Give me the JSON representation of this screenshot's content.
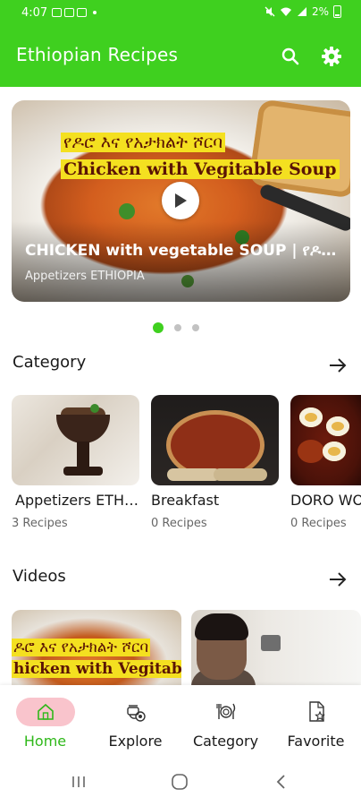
{
  "status_bar": {
    "time": "4:07",
    "battery": "2%"
  },
  "app_bar": {
    "title": "Ethiopian Recipes",
    "search_icon": "search-icon",
    "settings_icon": "gear-icon",
    "color": "#3fd01f"
  },
  "featured": {
    "caption_amharic": "የዶሮ እና የአታክልት ሾርባ",
    "caption_english": "Chicken with Vegitable Soup",
    "title": "CHICKEN with vegetable SOUP | የዶሮ...",
    "channel": "Appetizers ETHIOPIA",
    "active_page": 1,
    "page_count": 3
  },
  "category_section": {
    "title": "Category",
    "items": [
      {
        "name": "Appetizers ETHI...",
        "count": "3 Recipes"
      },
      {
        "name": "Breakfast",
        "count": "0 Recipes"
      },
      {
        "name": "DORO WO",
        "count": "0 Recipes"
      }
    ]
  },
  "videos_section": {
    "title": "Videos",
    "items": [
      {
        "caption_amharic": "ዶሮ እና የአታክልት ሾርባ",
        "caption_english": "hicken with Vegitable S"
      },
      {
        "caption_amharic": "",
        "caption_english": ""
      }
    ]
  },
  "bottom_nav": {
    "items": [
      {
        "label": "Home",
        "icon": "home-icon",
        "active": true
      },
      {
        "label": "Explore",
        "icon": "explore-icon",
        "active": false
      },
      {
        "label": "Category",
        "icon": "cutlery-icon",
        "active": false
      },
      {
        "label": "Favorite",
        "icon": "favorite-icon",
        "active": false
      }
    ],
    "active_color": "#2fb81a",
    "active_pill_color": "#f9c4cc"
  }
}
